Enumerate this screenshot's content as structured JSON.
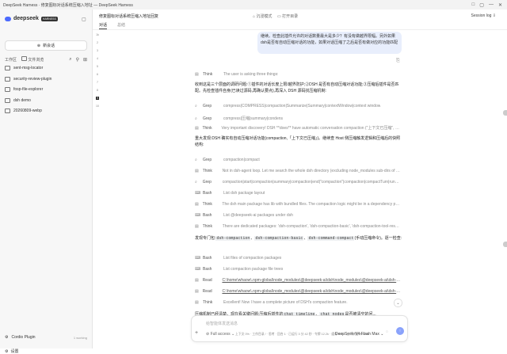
{
  "window": {
    "title": "DeepSeek Harness · 修复图标对话系统压缩入地址 — DeepSeek Harness",
    "controls": [
      "□",
      "▢",
      "—",
      "✕"
    ]
  },
  "sidebar": {
    "brand": "deepseek",
    "brand_tag": "HARNESS",
    "new_chat": "新会话",
    "workspace_label": "工作区",
    "folder_label": "文件浏览",
    "projects": [
      "sent-msg-locator",
      "security-review-plugin",
      "fosp-file-explorer",
      "dsh demo",
      "20260809-webp"
    ],
    "plugin": {
      "name": "Cordio Plugin",
      "status": "1 working"
    },
    "settings": "设置"
  },
  "header": {
    "title": "修复图标对话系统压缩入地址回复",
    "mode": "沉浸模式",
    "open_dir": "打开目录",
    "session": "Session log",
    "tabs": [
      "对话",
      "总结"
    ]
  },
  "ruler": [
    "1k",
    "2",
    "3",
    "4",
    "5",
    "6",
    "7",
    "8",
    "9",
    "10"
  ],
  "user_message": "继续。检查此插件允许的对话数量最大是多少？有没有做越界限幅。另外如果dsh是否有自动压缩对话的功能，如果对话压缩了之后是否有做对应的功能匹配",
  "thread": [
    {
      "kind": "tool",
      "icon": "think",
      "tool": "Think",
      "detail": "The user is asking three things:"
    },
    {
      "kind": "para",
      "text": "收到这是三个层面的调研问题:①插件的对话长度上限/越界防护;②DSH 是否有自动压缩对话功能;③压缩后插件是否匹配。先检查插件自身(已读过源码,再确认要点),再深入 DSH 源码找压缩机制:"
    },
    {
      "kind": "tool",
      "icon": "grep",
      "tool": "Grep",
      "detail": "compress|COMPRESS|compaction|Summarize|Summary|contextWindow|context window"
    },
    {
      "kind": "tool",
      "icon": "grep",
      "tool": "Grep",
      "detail": "compress|压缩|summary|condens"
    },
    {
      "kind": "tool",
      "icon": "think",
      "tool": "Think",
      "detail": "Very important discovery! DSH **does** have automatic conversation compaction (\"上下文已压缩\", compaction..."
    },
    {
      "kind": "para",
      "text": "重大发现:DSH 确实有自动压缩对话功能(compaction,「上下文已压缩」)。继续查 Host 侧压缩触发逻辑和压缩后的快照结构:"
    },
    {
      "kind": "tool",
      "icon": "grep",
      "tool": "Grep",
      "detail": "compaction|compact"
    },
    {
      "kind": "tool",
      "icon": "think",
      "tool": "Think",
      "detail": "Not in dsh-agent loop. Let me search the whole dsh directory (excluding node_modules sub-dirs of third-p..."
    },
    {
      "kind": "tool",
      "icon": "grep",
      "tool": "Grep",
      "detail": "compaction|start|compaction|summary|compaction|end|\"compaction\"|compaction|compactTurn|runComp..."
    },
    {
      "kind": "tool",
      "icon": "bash",
      "tool": "Bash",
      "detail": "List dsh package layout"
    },
    {
      "kind": "tool",
      "icon": "think",
      "tool": "Think",
      "detail": "The dsh main package has lib with bundled files. The compaction logic might be in a dependency package..."
    },
    {
      "kind": "tool",
      "icon": "bash",
      "tool": "Bash",
      "detail": "List @deepseek-ai packages under dsh"
    },
    {
      "kind": "tool",
      "icon": "think",
      "tool": "Think",
      "detail": "There are dedicated packages: 'dsh-compaction', 'dsh-compaction-basic', 'dsh-compaction-tool-result-pru..."
    },
    {
      "kind": "para_code",
      "prefix": "发现专门包:",
      "codes": [
        "dsh-compaction",
        "dsh-compaction-basic",
        "dsh-command-compact"
      ],
      "suffix": "(手动压缩命令)。逐一检查:"
    },
    {
      "kind": "tool",
      "icon": "bash",
      "tool": "Bash",
      "detail": "List files of compaction packages"
    },
    {
      "kind": "tool",
      "icon": "bash",
      "tool": "Bash",
      "detail": "List compaction package file trees"
    },
    {
      "kind": "tool",
      "icon": "read",
      "tool": "Read",
      "detail": "C:\\home\\whaow\\.npm-global\\node_modules\\@deepseek-ai\\dsh\\node_modules\\@deepseek-ai\\dsh-compa...",
      "link": true
    },
    {
      "kind": "tool",
      "icon": "read",
      "tool": "Read",
      "detail": "C:\\home\\whaow\\.npm-global\\node_modules\\@deepseek-ai\\dsh\\node_modules\\@deepseek-ai\\dsh-compa...",
      "link": true
    },
    {
      "kind": "tool",
      "icon": "think",
      "tool": "Think",
      "detail": "Excellent! Now I have a complete picture of DSH's compaction feature."
    },
    {
      "kind": "para_code_tail",
      "prefix": "压缩机制已经清楚。现在看关键问题:压缩后插件的",
      "codes": [
        "chat_timeline",
        "chat_nodes"
      ],
      "suffix": "是否被清空的问..."
    }
  ],
  "composer": {
    "placeholder": "给智能体发送消息",
    "access": "Full access",
    "status": "上下文 0% · 工作目录 / · 思考 · 回合 1 · 已运行 3 分 42 秒 · 令牌 12.2k · 缓存 4.0k · 上下文窗口 128k",
    "model": "DeepSeek-V4-Flash  Max",
    "send_icon": "↑"
  }
}
